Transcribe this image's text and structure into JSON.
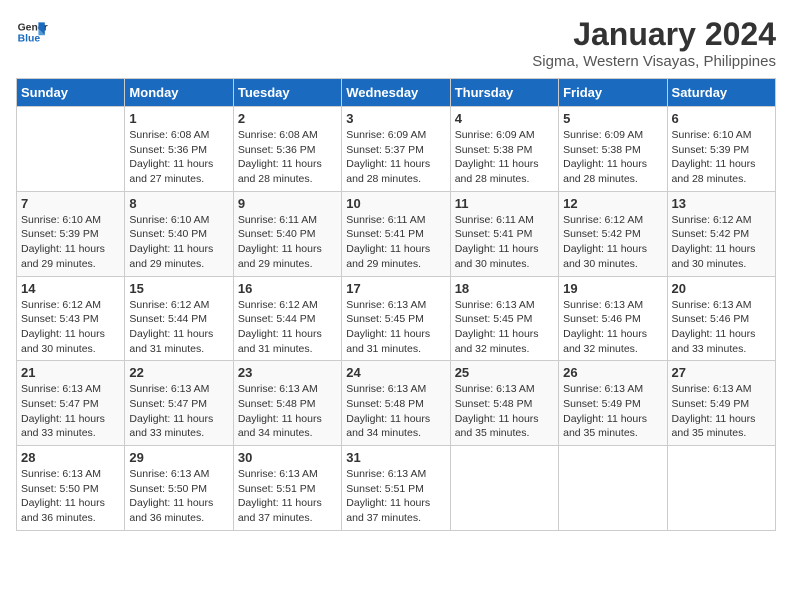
{
  "logo": {
    "line1": "General",
    "line2": "Blue"
  },
  "title": "January 2024",
  "location": "Sigma, Western Visayas, Philippines",
  "days_header": [
    "Sunday",
    "Monday",
    "Tuesday",
    "Wednesday",
    "Thursday",
    "Friday",
    "Saturday"
  ],
  "weeks": [
    [
      {
        "day": "",
        "info": ""
      },
      {
        "day": "1",
        "info": "Sunrise: 6:08 AM\nSunset: 5:36 PM\nDaylight: 11 hours\nand 27 minutes."
      },
      {
        "day": "2",
        "info": "Sunrise: 6:08 AM\nSunset: 5:36 PM\nDaylight: 11 hours\nand 28 minutes."
      },
      {
        "day": "3",
        "info": "Sunrise: 6:09 AM\nSunset: 5:37 PM\nDaylight: 11 hours\nand 28 minutes."
      },
      {
        "day": "4",
        "info": "Sunrise: 6:09 AM\nSunset: 5:38 PM\nDaylight: 11 hours\nand 28 minutes."
      },
      {
        "day": "5",
        "info": "Sunrise: 6:09 AM\nSunset: 5:38 PM\nDaylight: 11 hours\nand 28 minutes."
      },
      {
        "day": "6",
        "info": "Sunrise: 6:10 AM\nSunset: 5:39 PM\nDaylight: 11 hours\nand 28 minutes."
      }
    ],
    [
      {
        "day": "7",
        "info": "Sunrise: 6:10 AM\nSunset: 5:39 PM\nDaylight: 11 hours\nand 29 minutes."
      },
      {
        "day": "8",
        "info": "Sunrise: 6:10 AM\nSunset: 5:40 PM\nDaylight: 11 hours\nand 29 minutes."
      },
      {
        "day": "9",
        "info": "Sunrise: 6:11 AM\nSunset: 5:40 PM\nDaylight: 11 hours\nand 29 minutes."
      },
      {
        "day": "10",
        "info": "Sunrise: 6:11 AM\nSunset: 5:41 PM\nDaylight: 11 hours\nand 29 minutes."
      },
      {
        "day": "11",
        "info": "Sunrise: 6:11 AM\nSunset: 5:41 PM\nDaylight: 11 hours\nand 30 minutes."
      },
      {
        "day": "12",
        "info": "Sunrise: 6:12 AM\nSunset: 5:42 PM\nDaylight: 11 hours\nand 30 minutes."
      },
      {
        "day": "13",
        "info": "Sunrise: 6:12 AM\nSunset: 5:42 PM\nDaylight: 11 hours\nand 30 minutes."
      }
    ],
    [
      {
        "day": "14",
        "info": "Sunrise: 6:12 AM\nSunset: 5:43 PM\nDaylight: 11 hours\nand 30 minutes."
      },
      {
        "day": "15",
        "info": "Sunrise: 6:12 AM\nSunset: 5:44 PM\nDaylight: 11 hours\nand 31 minutes."
      },
      {
        "day": "16",
        "info": "Sunrise: 6:12 AM\nSunset: 5:44 PM\nDaylight: 11 hours\nand 31 minutes."
      },
      {
        "day": "17",
        "info": "Sunrise: 6:13 AM\nSunset: 5:45 PM\nDaylight: 11 hours\nand 31 minutes."
      },
      {
        "day": "18",
        "info": "Sunrise: 6:13 AM\nSunset: 5:45 PM\nDaylight: 11 hours\nand 32 minutes."
      },
      {
        "day": "19",
        "info": "Sunrise: 6:13 AM\nSunset: 5:46 PM\nDaylight: 11 hours\nand 32 minutes."
      },
      {
        "day": "20",
        "info": "Sunrise: 6:13 AM\nSunset: 5:46 PM\nDaylight: 11 hours\nand 33 minutes."
      }
    ],
    [
      {
        "day": "21",
        "info": "Sunrise: 6:13 AM\nSunset: 5:47 PM\nDaylight: 11 hours\nand 33 minutes."
      },
      {
        "day": "22",
        "info": "Sunrise: 6:13 AM\nSunset: 5:47 PM\nDaylight: 11 hours\nand 33 minutes."
      },
      {
        "day": "23",
        "info": "Sunrise: 6:13 AM\nSunset: 5:48 PM\nDaylight: 11 hours\nand 34 minutes."
      },
      {
        "day": "24",
        "info": "Sunrise: 6:13 AM\nSunset: 5:48 PM\nDaylight: 11 hours\nand 34 minutes."
      },
      {
        "day": "25",
        "info": "Sunrise: 6:13 AM\nSunset: 5:48 PM\nDaylight: 11 hours\nand 35 minutes."
      },
      {
        "day": "26",
        "info": "Sunrise: 6:13 AM\nSunset: 5:49 PM\nDaylight: 11 hours\nand 35 minutes."
      },
      {
        "day": "27",
        "info": "Sunrise: 6:13 AM\nSunset: 5:49 PM\nDaylight: 11 hours\nand 35 minutes."
      }
    ],
    [
      {
        "day": "28",
        "info": "Sunrise: 6:13 AM\nSunset: 5:50 PM\nDaylight: 11 hours\nand 36 minutes."
      },
      {
        "day": "29",
        "info": "Sunrise: 6:13 AM\nSunset: 5:50 PM\nDaylight: 11 hours\nand 36 minutes."
      },
      {
        "day": "30",
        "info": "Sunrise: 6:13 AM\nSunset: 5:51 PM\nDaylight: 11 hours\nand 37 minutes."
      },
      {
        "day": "31",
        "info": "Sunrise: 6:13 AM\nSunset: 5:51 PM\nDaylight: 11 hours\nand 37 minutes."
      },
      {
        "day": "",
        "info": ""
      },
      {
        "day": "",
        "info": ""
      },
      {
        "day": "",
        "info": ""
      }
    ]
  ]
}
